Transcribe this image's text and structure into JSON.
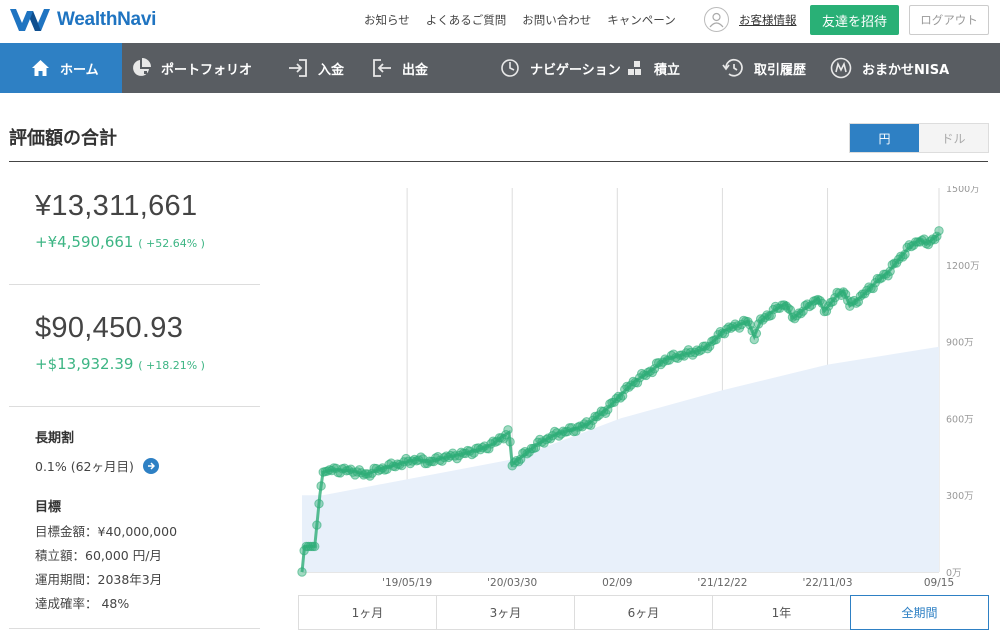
{
  "brand": {
    "name": "WealthNavi",
    "color": "#1f74c1"
  },
  "header": {
    "links": [
      "お知らせ",
      "よくあるご質問",
      "お問い合わせ",
      "キャンペーン"
    ],
    "user_label": "お客様情報",
    "invite_label": "友達を招待",
    "logout_label": "ログアウト"
  },
  "nav": {
    "items": [
      {
        "label": "ホーム",
        "icon": "home-icon",
        "active": true
      },
      {
        "label": "ポートフォリオ",
        "icon": "pie-chart-icon"
      },
      {
        "label": "入金",
        "icon": "deposit-icon"
      },
      {
        "label": "出金",
        "icon": "withdraw-icon"
      },
      {
        "label": "ナビゲーション",
        "icon": "navigation-icon"
      },
      {
        "label": "積立",
        "icon": "accumulate-icon"
      },
      {
        "label": "取引履歴",
        "icon": "history-icon"
      },
      {
        "label": "おまかせNISA",
        "icon": "nisa-icon"
      }
    ],
    "bg_color": "#595d62",
    "active_color": "#2e80c4"
  },
  "page": {
    "title": "評価額の合計"
  },
  "currency_toggle": {
    "yen": "円",
    "usd": "ドル",
    "selected": "円"
  },
  "summary": {
    "jpy": {
      "total": "¥13,311,661",
      "gain": "+¥4,590,661",
      "gain_pct": "( +52.64% )"
    },
    "usd": {
      "total": "$90,450.93",
      "gain": "+$13,932.39",
      "gain_pct": "( +18.21% )"
    },
    "gain_color": "#3db584"
  },
  "long_term": {
    "label": "長期割",
    "value": "0.1% (62ヶ月目)"
  },
  "goal": {
    "label": "目標",
    "lines": [
      "目標金額：¥40,000,000",
      "積立額：60,000 円/月",
      "運用期間：2038年3月",
      "達成確率： 48%"
    ]
  },
  "periods": {
    "items": [
      "1ヶ月",
      "3ヶ月",
      "6ヶ月",
      "1年",
      "全期間"
    ],
    "selected": "全期間"
  },
  "chart_data": {
    "type": "area",
    "y_unit": "万",
    "y_tick_labels": [
      "0万",
      "300万",
      "600万",
      "900万",
      "1200万",
      "1500万"
    ],
    "y_ticks": [
      0,
      300,
      600,
      900,
      1200,
      1500
    ],
    "ylim": [
      0,
      1500
    ],
    "x_tick_labels": [
      "'19/05/19",
      "'20/03/30",
      "02/09",
      "'21/12/22",
      "'22/11/03",
      "09/15"
    ],
    "x_ticks_index": [
      0.165,
      0.33,
      0.495,
      0.66,
      0.825,
      1.0
    ],
    "grid": "vertical",
    "series": [
      {
        "color": "#2eae78",
        "points": [
          [
            0,
            0
          ],
          [
            0.004,
            100
          ],
          [
            0.02,
            100
          ],
          [
            0.024,
            200
          ],
          [
            0.028,
            300
          ],
          [
            0.033,
            390
          ],
          [
            0.05,
            400
          ],
          [
            0.08,
            395
          ],
          [
            0.1,
            380
          ],
          [
            0.12,
            400
          ],
          [
            0.15,
            420
          ],
          [
            0.18,
            440
          ],
          [
            0.2,
            430
          ],
          [
            0.22,
            445
          ],
          [
            0.25,
            460
          ],
          [
            0.28,
            480
          ],
          [
            0.3,
            500
          ],
          [
            0.315,
            530
          ],
          [
            0.325,
            545
          ],
          [
            0.33,
            420
          ],
          [
            0.345,
            450
          ],
          [
            0.37,
            500
          ],
          [
            0.4,
            540
          ],
          [
            0.43,
            560
          ],
          [
            0.45,
            580
          ],
          [
            0.48,
            640
          ],
          [
            0.5,
            690
          ],
          [
            0.52,
            740
          ],
          [
            0.55,
            790
          ],
          [
            0.57,
            830
          ],
          [
            0.6,
            850
          ],
          [
            0.63,
            870
          ],
          [
            0.65,
            910
          ],
          [
            0.66,
            940
          ],
          [
            0.68,
            960
          ],
          [
            0.7,
            980
          ],
          [
            0.71,
            920
          ],
          [
            0.72,
            980
          ],
          [
            0.74,
            1020
          ],
          [
            0.76,
            1050
          ],
          [
            0.77,
            990
          ],
          [
            0.79,
            1030
          ],
          [
            0.81,
            1070
          ],
          [
            0.82,
            1020
          ],
          [
            0.84,
            1080
          ],
          [
            0.85,
            1100
          ],
          [
            0.86,
            1040
          ],
          [
            0.88,
            1080
          ],
          [
            0.9,
            1130
          ],
          [
            0.92,
            1170
          ],
          [
            0.93,
            1200
          ],
          [
            0.95,
            1260
          ],
          [
            0.97,
            1300
          ],
          [
            0.98,
            1280
          ],
          [
            1.0,
            1320
          ]
        ]
      },
      {
        "color": "#e8f0fa",
        "points": [
          [
            0,
            300
          ],
          [
            0.033,
            300
          ],
          [
            0.33,
            440
          ],
          [
            0.5,
            600
          ],
          [
            0.66,
            710
          ],
          [
            0.825,
            810
          ],
          [
            1.0,
            880
          ]
        ]
      }
    ]
  }
}
